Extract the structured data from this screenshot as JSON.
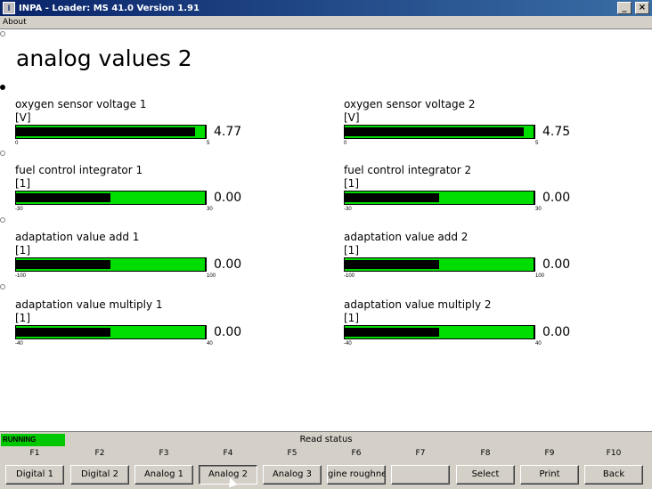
{
  "window": {
    "title": "INPA - Loader:  MS 41.0 Version 1.91",
    "minimize": "_",
    "close": "×"
  },
  "menu": {
    "about": "About"
  },
  "page": {
    "title": "analog values 2"
  },
  "gauges": [
    {
      "label": "oxygen sensor voltage  1",
      "unit": "[V]",
      "value": "4.77",
      "min": "0",
      "max": "5",
      "fraction": 0.95
    },
    {
      "label": "oxygen sensor voltage  2",
      "unit": "[V]",
      "value": "4.75",
      "min": "0",
      "max": "5",
      "fraction": 0.95
    },
    {
      "label": "fuel control integrator 1",
      "unit": "[1]",
      "value": "0.00",
      "min": "-30",
      "max": "30",
      "fraction": 0.5
    },
    {
      "label": "fuel control integrator 2",
      "unit": "[1]",
      "value": "0.00",
      "min": "-30",
      "max": "30",
      "fraction": 0.5
    },
    {
      "label": "adaptation value add 1",
      "unit": "[1]",
      "value": "0.00",
      "min": "-100",
      "max": "100",
      "fraction": 0.5
    },
    {
      "label": "adaptation value add 2",
      "unit": "[1]",
      "value": "0.00",
      "min": "-100",
      "max": "100",
      "fraction": 0.5
    },
    {
      "label": "adaptation value multiply 1",
      "unit": "[1]",
      "value": "0.00",
      "min": "-40",
      "max": "40",
      "fraction": 0.5
    },
    {
      "label": "adaptation value multiply 2",
      "unit": "[1]",
      "value": "0.00",
      "min": "-40",
      "max": "40",
      "fraction": 0.5
    }
  ],
  "status": {
    "running": "RUNNING",
    "text": "Read status"
  },
  "fkeys": [
    {
      "key": "F1",
      "label": "Digital 1"
    },
    {
      "key": "F2",
      "label": "Digital 2"
    },
    {
      "key": "F3",
      "label": "Analog 1"
    },
    {
      "key": "F4",
      "label": "Analog 2"
    },
    {
      "key": "F5",
      "label": "Analog 3"
    },
    {
      "key": "F6",
      "label": "gine roughne"
    },
    {
      "key": "F7",
      "label": ""
    },
    {
      "key": "F8",
      "label": "Select"
    },
    {
      "key": "F9",
      "label": "Print"
    },
    {
      "key": "F10",
      "label": "Back"
    }
  ],
  "colors": {
    "bar_fill": "#00dd00",
    "bar_level": "#000000",
    "running": "#00c800"
  }
}
